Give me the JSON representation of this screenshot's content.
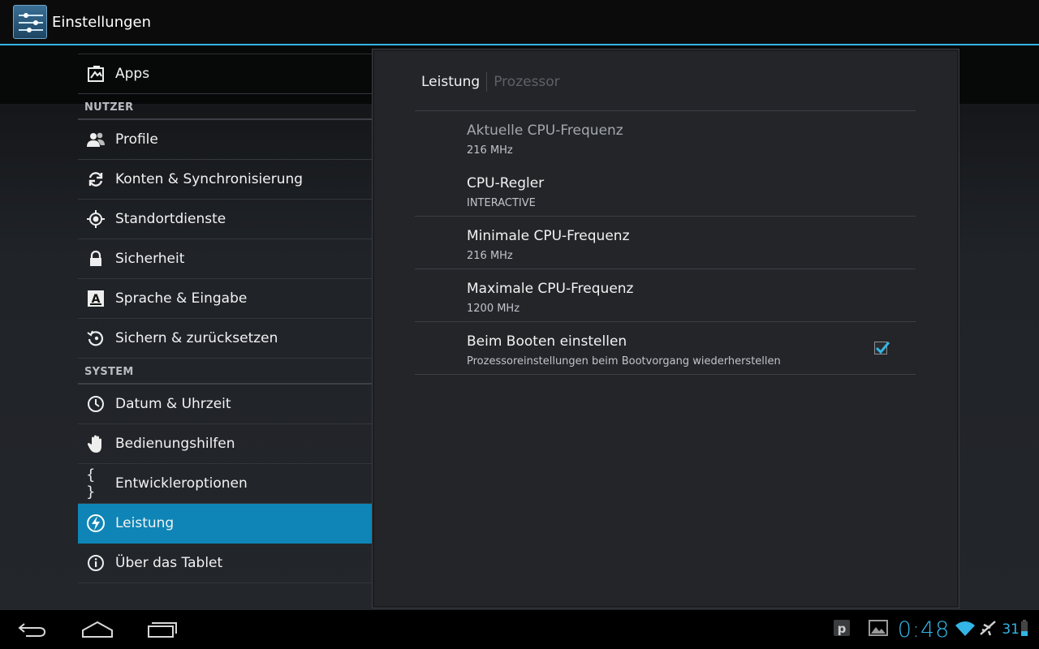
{
  "action_bar": {
    "title": "Einstellungen"
  },
  "sidebar": {
    "apps_label": "Apps",
    "section_user": "NUTZER",
    "user_items": [
      {
        "label": "Profile",
        "icon": "profile-icon"
      },
      {
        "label": "Konten & Synchronisierung",
        "icon": "sync-icon"
      },
      {
        "label": "Standortdienste",
        "icon": "location-icon"
      },
      {
        "label": "Sicherheit",
        "icon": "lock-icon"
      },
      {
        "label": "Sprache & Eingabe",
        "icon": "language-icon"
      },
      {
        "label": "Sichern & zurücksetzen",
        "icon": "backup-icon"
      }
    ],
    "section_system": "SYSTEM",
    "system_items": [
      {
        "label": "Datum & Uhrzeit",
        "icon": "clock-icon"
      },
      {
        "label": "Bedienungshilfen",
        "icon": "accessibility-hand-icon"
      },
      {
        "label": "Entwickleroptionen",
        "icon": "developer-braces-icon",
        "glyph": "{ }"
      },
      {
        "label": "Leistung",
        "icon": "performance-bolt-icon",
        "active": true
      },
      {
        "label": "Über das Tablet",
        "icon": "info-icon"
      }
    ]
  },
  "panel": {
    "tabs": [
      {
        "label": "Leistung",
        "active": true
      },
      {
        "label": "Prozessor",
        "active": false
      }
    ],
    "prefs": [
      {
        "title": "Aktuelle CPU-Frequenz",
        "summary": "216 MHz",
        "enabled": false
      },
      {
        "title": "CPU-Regler",
        "summary": "INTERACTIVE",
        "enabled": true
      },
      {
        "title": "Minimale CPU-Frequenz",
        "summary": "216 MHz",
        "enabled": true
      },
      {
        "title": "Maximale CPU-Frequenz",
        "summary": "1200 MHz",
        "enabled": true
      },
      {
        "title": "Beim Booten einstellen",
        "summary": "Prozessoreinstellungen beim Bootvorgang wiederherstellen",
        "enabled": true,
        "checkbox": true,
        "checked": true
      }
    ]
  },
  "status_bar": {
    "clock": "0:48",
    "battery": "31",
    "notification_icons": [
      "p-notification-icon",
      "image-notification-icon"
    ],
    "status_icons": [
      "wifi-icon",
      "airplane-icon",
      "battery-icon"
    ]
  },
  "colors": {
    "accent": "#33b5e5",
    "selected": "#0e85b6"
  }
}
